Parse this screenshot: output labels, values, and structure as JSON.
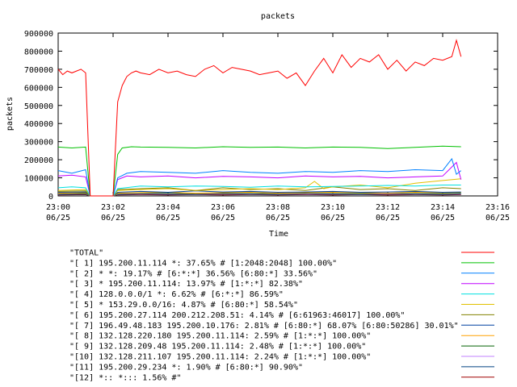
{
  "chart_data": {
    "type": "line",
    "title": "packets",
    "xlabel": "Time",
    "ylabel": "packets",
    "ylim": [
      0,
      900000
    ],
    "xlim": [
      "23:00",
      "23:16"
    ],
    "grid": false,
    "legend_placement": "bottom",
    "y_ticks": [
      "0",
      "100000",
      "200000",
      "300000",
      "400000",
      "500000",
      "600000",
      "700000",
      "800000",
      "900000"
    ],
    "x_ticks": [
      {
        "time": "23:00",
        "date": "06/25"
      },
      {
        "time": "23:02",
        "date": "06/25"
      },
      {
        "time": "23:04",
        "date": "06/25"
      },
      {
        "time": "23:06",
        "date": "06/25"
      },
      {
        "time": "23:08",
        "date": "06/25"
      },
      {
        "time": "23:10",
        "date": "06/25"
      },
      {
        "time": "23:12",
        "date": "06/25"
      },
      {
        "time": "23:14",
        "date": "06/25"
      },
      {
        "time": "23:16",
        "date": "06/25"
      }
    ],
    "series": [
      {
        "name": "\"TOTAL\"",
        "color": "#ff0000",
        "x": [
          "23:00:00",
          "23:00:10",
          "23:00:20",
          "23:00:30",
          "23:00:40",
          "23:00:50",
          "23:01:00",
          "23:01:10",
          "23:01:20",
          "23:01:30",
          "23:01:40",
          "23:01:50",
          "23:02:00",
          "23:02:10",
          "23:02:20",
          "23:02:30",
          "23:02:40",
          "23:02:50",
          "23:03:00",
          "23:03:20",
          "23:03:40",
          "23:04:00",
          "23:04:20",
          "23:04:40",
          "23:05:00",
          "23:05:20",
          "23:05:40",
          "23:06:00",
          "23:06:20",
          "23:06:40",
          "23:07:00",
          "23:07:20",
          "23:07:40",
          "23:08:00",
          "23:08:20",
          "23:08:40",
          "23:09:00",
          "23:09:20",
          "23:09:40",
          "23:10:00",
          "23:10:20",
          "23:10:40",
          "23:11:00",
          "23:11:20",
          "23:11:40",
          "23:12:00",
          "23:12:20",
          "23:12:40",
          "23:13:00",
          "23:13:20",
          "23:13:40",
          "23:14:00",
          "23:14:20",
          "23:14:30",
          "23:14:40"
        ],
        "values": [
          700000,
          670000,
          690000,
          680000,
          690000,
          700000,
          680000,
          0,
          0,
          0,
          0,
          0,
          0,
          520000,
          610000,
          660000,
          680000,
          690000,
          680000,
          670000,
          700000,
          680000,
          690000,
          670000,
          660000,
          700000,
          720000,
          680000,
          710000,
          700000,
          690000,
          670000,
          680000,
          690000,
          650000,
          680000,
          610000,
          690000,
          760000,
          680000,
          780000,
          710000,
          760000,
          740000,
          780000,
          700000,
          750000,
          690000,
          740000,
          720000,
          760000,
          750000,
          770000,
          860000,
          770000
        ]
      },
      {
        "name": "\"[ 1] 195.200.11.114 *: 37.65% # [1:2048:2048] 100.00%\"",
        "color": "#00c000",
        "x": [
          "23:00:00",
          "23:00:30",
          "23:01:00",
          "23:01:10",
          "23:01:20",
          "23:01:30",
          "23:01:40",
          "23:01:50",
          "23:02:00",
          "23:02:10",
          "23:02:20",
          "23:02:40",
          "23:03:00",
          "23:04:00",
          "23:05:00",
          "23:06:00",
          "23:07:00",
          "23:08:00",
          "23:09:00",
          "23:10:00",
          "23:11:00",
          "23:12:00",
          "23:13:00",
          "23:14:00",
          "23:14:40"
        ],
        "values": [
          270000,
          265000,
          270000,
          0,
          0,
          0,
          0,
          0,
          0,
          230000,
          265000,
          272000,
          270000,
          268000,
          265000,
          272000,
          268000,
          270000,
          265000,
          270000,
          268000,
          262000,
          268000,
          275000,
          272000
        ]
      },
      {
        "name": "\"[ 2] * *: 19.17% # [6:*:*] 36.56% [6:80:*] 33.56%\"",
        "color": "#0080ff",
        "x": [
          "23:00:00",
          "23:00:30",
          "23:01:00",
          "23:01:10",
          "23:01:20",
          "23:01:30",
          "23:01:40",
          "23:01:50",
          "23:02:00",
          "23:02:10",
          "23:02:30",
          "23:03:00",
          "23:04:00",
          "23:05:00",
          "23:06:00",
          "23:07:00",
          "23:08:00",
          "23:09:00",
          "23:10:00",
          "23:11:00",
          "23:12:00",
          "23:13:00",
          "23:14:00",
          "23:14:20",
          "23:14:30",
          "23:14:40"
        ],
        "values": [
          140000,
          125000,
          145000,
          0,
          0,
          0,
          0,
          0,
          0,
          100000,
          125000,
          135000,
          130000,
          125000,
          140000,
          130000,
          125000,
          135000,
          130000,
          140000,
          135000,
          145000,
          140000,
          205000,
          120000,
          140000
        ]
      },
      {
        "name": "\"[ 3] * 195.200.11.114: 13.97% # [1:*:*] 82.38%\"",
        "color": "#c000ff",
        "x": [
          "23:00:00",
          "23:00:30",
          "23:01:00",
          "23:01:10",
          "23:01:20",
          "23:01:30",
          "23:01:40",
          "23:01:50",
          "23:02:00",
          "23:02:10",
          "23:02:30",
          "23:03:00",
          "23:04:00",
          "23:05:00",
          "23:06:00",
          "23:07:00",
          "23:08:00",
          "23:09:00",
          "23:10:00",
          "23:11:00",
          "23:12:00",
          "23:13:00",
          "23:14:00",
          "23:14:30",
          "23:14:40"
        ],
        "values": [
          110000,
          115000,
          105000,
          0,
          0,
          0,
          0,
          0,
          0,
          90000,
          110000,
          105000,
          110000,
          100000,
          108000,
          105000,
          100000,
          110000,
          105000,
          108000,
          100000,
          105000,
          110000,
          185000,
          90000
        ]
      },
      {
        "name": "\"[ 4] 128.0.0.0/1 *: 6.62% # [6:*:*] 86.59%\"",
        "color": "#00e0e0",
        "x": [
          "23:00:00",
          "23:00:30",
          "23:01:00",
          "23:01:10",
          "23:01:20",
          "23:01:30",
          "23:01:40",
          "23:01:50",
          "23:02:00",
          "23:02:10",
          "23:03:00",
          "23:04:00",
          "23:05:00",
          "23:06:00",
          "23:07:00",
          "23:08:00",
          "23:09:00",
          "23:10:00",
          "23:11:00",
          "23:12:00",
          "23:13:00",
          "23:14:00",
          "23:14:40"
        ],
        "values": [
          45000,
          50000,
          45000,
          0,
          0,
          0,
          0,
          0,
          0,
          40000,
          55000,
          50000,
          55000,
          52000,
          48000,
          55000,
          50000,
          52000,
          55000,
          58000,
          55000,
          60000,
          60000
        ]
      },
      {
        "name": "\"[ 5] * 153.29.0.0/16: 4.87% # [6:80:*] 58.54%\"",
        "color": "#e0c000",
        "x": [
          "23:00:00",
          "23:01:00",
          "23:01:10",
          "23:01:20",
          "23:01:30",
          "23:01:40",
          "23:01:50",
          "23:02:00",
          "23:02:10",
          "23:03:00",
          "23:04:00",
          "23:05:00",
          "23:06:00",
          "23:07:00",
          "23:08:00",
          "23:09:00",
          "23:09:20",
          "23:09:40",
          "23:10:00",
          "23:11:00",
          "23:12:00",
          "23:13:00",
          "23:14:00",
          "23:14:40"
        ],
        "values": [
          30000,
          35000,
          0,
          0,
          0,
          0,
          0,
          0,
          30000,
          35000,
          40000,
          30000,
          35000,
          40000,
          35000,
          45000,
          80000,
          40000,
          50000,
          60000,
          45000,
          70000,
          85000,
          95000
        ]
      },
      {
        "name": "\"[ 6] 195.200.27.114 200.212.208.51: 4.14% # [6:61963:46017] 100.00%\"",
        "color": "#808000",
        "x": [
          "23:00:00",
          "23:01:00",
          "23:01:10",
          "23:01:20",
          "23:01:30",
          "23:01:40",
          "23:01:50",
          "23:02:00",
          "23:02:10",
          "23:03:00",
          "23:04:00",
          "23:05:00",
          "23:06:00",
          "23:07:00",
          "23:08:00",
          "23:09:00",
          "23:10:00",
          "23:11:00",
          "23:12:00",
          "23:13:00",
          "23:14:00",
          "23:14:40"
        ],
        "values": [
          25000,
          28000,
          0,
          0,
          0,
          0,
          0,
          0,
          35000,
          40000,
          45000,
          30000,
          45000,
          35000,
          40000,
          30000,
          50000,
          35000,
          40000,
          30000,
          45000,
          40000
        ]
      },
      {
        "name": "\"[ 7] 196.49.48.183 195.200.10.176: 2.81% # [6:80:*] 68.07% [6:80:50286] 30.01%\"",
        "color": "#0040a0",
        "x": [
          "23:00:00",
          "23:01:00",
          "23:01:10",
          "23:01:20",
          "23:01:30",
          "23:01:40",
          "23:01:50",
          "23:02:00",
          "23:02:10",
          "23:03:00",
          "23:04:00",
          "23:05:00",
          "23:06:00",
          "23:07:00",
          "23:08:00",
          "23:09:00",
          "23:10:00",
          "23:11:00",
          "23:12:00",
          "23:13:00",
          "23:14:00",
          "23:14:40"
        ],
        "values": [
          20000,
          22000,
          0,
          0,
          0,
          0,
          0,
          0,
          20000,
          25000,
          20000,
          28000,
          22000,
          25000,
          20000,
          22000,
          25000,
          20000,
          22000,
          25000,
          20000,
          22000
        ]
      },
      {
        "name": "\"[ 8] 132.128.220.180 195.200.11.114: 2.59% # [1:*:*] 100.00%\"",
        "color": "#ffa000",
        "x": [
          "23:00:00",
          "23:01:00",
          "23:01:10",
          "23:01:20",
          "23:01:30",
          "23:01:40",
          "23:01:50",
          "23:02:00",
          "23:02:10",
          "23:03:00",
          "23:04:00",
          "23:05:00",
          "23:06:00",
          "23:07:00",
          "23:08:00",
          "23:09:00",
          "23:10:00",
          "23:11:00",
          "23:12:00",
          "23:13:00",
          "23:14:00",
          "23:14:40"
        ],
        "values": [
          15000,
          18000,
          0,
          0,
          0,
          0,
          0,
          0,
          15000,
          18000,
          20000,
          15000,
          18000,
          20000,
          15000,
          18000,
          20000,
          18000,
          15000,
          20000,
          18000,
          20000
        ]
      },
      {
        "name": "\"[ 9] 132.128.209.48 195.200.11.114: 2.48% # [1:*:*] 100.00%\"",
        "color": "#006000",
        "x": [
          "23:00:00",
          "23:01:00",
          "23:01:10",
          "23:01:20",
          "23:01:30",
          "23:01:40",
          "23:01:50",
          "23:02:00",
          "23:02:10",
          "23:03:00",
          "23:04:00",
          "23:05:00",
          "23:06:00",
          "23:07:00",
          "23:08:00",
          "23:09:00",
          "23:10:00",
          "23:11:00",
          "23:12:00",
          "23:13:00",
          "23:14:00",
          "23:14:40"
        ],
        "values": [
          12000,
          14000,
          0,
          0,
          0,
          0,
          0,
          0,
          12000,
          15000,
          14000,
          12000,
          15000,
          14000,
          12000,
          15000,
          14000,
          12000,
          15000,
          14000,
          12000,
          15000
        ]
      },
      {
        "name": "\"[10] 132.128.211.107 195.200.11.114: 2.24% # [1:*:*] 100.00%\"",
        "color": "#c080ff",
        "x": [
          "23:00:00",
          "23:01:00",
          "23:01:10",
          "23:01:20",
          "23:01:30",
          "23:01:40",
          "23:01:50",
          "23:02:00",
          "23:02:10",
          "23:03:00",
          "23:04:00",
          "23:05:00",
          "23:06:00",
          "23:07:00",
          "23:08:00",
          "23:09:00",
          "23:10:00",
          "23:11:00",
          "23:12:00",
          "23:13:00",
          "23:14:00",
          "23:14:40"
        ],
        "values": [
          10000,
          12000,
          0,
          0,
          0,
          0,
          0,
          0,
          10000,
          12000,
          11000,
          10000,
          12000,
          11000,
          10000,
          12000,
          11000,
          10000,
          12000,
          11000,
          10000,
          12000
        ]
      },
      {
        "name": "\"[11] 195.200.29.234 *: 1.90% # [6:80:*] 90.90%\"",
        "color": "#004080",
        "x": [
          "23:00:00",
          "23:01:00",
          "23:01:10",
          "23:01:20",
          "23:01:30",
          "23:01:40",
          "23:01:50",
          "23:02:00",
          "23:02:10",
          "23:03:00",
          "23:04:00",
          "23:05:00",
          "23:06:00",
          "23:07:00",
          "23:08:00",
          "23:09:00",
          "23:10:00",
          "23:11:00",
          "23:12:00",
          "23:13:00",
          "23:14:00",
          "23:14:40"
        ],
        "values": [
          8000,
          10000,
          0,
          0,
          0,
          0,
          0,
          0,
          8000,
          10000,
          9000,
          8000,
          10000,
          9000,
          8000,
          10000,
          9000,
          8000,
          10000,
          9000,
          8000,
          10000
        ]
      },
      {
        "name": "\"[12] *:: *::: 1.56% #\"",
        "color": "#a00000",
        "x": [
          "23:00:00",
          "23:01:00",
          "23:01:10",
          "23:01:20",
          "23:01:30",
          "23:01:40",
          "23:01:50",
          "23:02:00",
          "23:02:10",
          "23:03:00",
          "23:04:00",
          "23:05:00",
          "23:06:00",
          "23:07:00",
          "23:08:00",
          "23:09:00",
          "23:10:00",
          "23:11:00",
          "23:12:00",
          "23:13:00",
          "23:14:00",
          "23:14:40"
        ],
        "values": [
          6000,
          7000,
          0,
          0,
          0,
          0,
          0,
          0,
          6000,
          7000,
          6000,
          7000,
          6000,
          7000,
          6000,
          7000,
          6000,
          7000,
          6000,
          7000,
          6000,
          7000
        ]
      }
    ]
  }
}
